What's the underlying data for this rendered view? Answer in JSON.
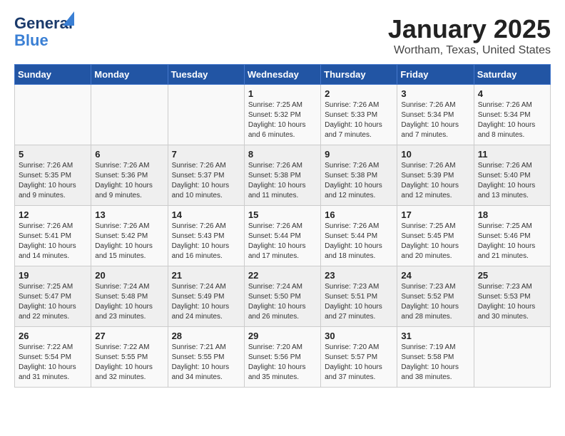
{
  "header": {
    "logo_line1": "General",
    "logo_line2": "Blue",
    "title": "January 2025",
    "subtitle": "Wortham, Texas, United States"
  },
  "weekdays": [
    "Sunday",
    "Monday",
    "Tuesday",
    "Wednesday",
    "Thursday",
    "Friday",
    "Saturday"
  ],
  "weeks": [
    [
      {
        "day": "",
        "info": ""
      },
      {
        "day": "",
        "info": ""
      },
      {
        "day": "",
        "info": ""
      },
      {
        "day": "1",
        "info": "Sunrise: 7:25 AM\nSunset: 5:32 PM\nDaylight: 10 hours\nand 6 minutes."
      },
      {
        "day": "2",
        "info": "Sunrise: 7:26 AM\nSunset: 5:33 PM\nDaylight: 10 hours\nand 7 minutes."
      },
      {
        "day": "3",
        "info": "Sunrise: 7:26 AM\nSunset: 5:34 PM\nDaylight: 10 hours\nand 7 minutes."
      },
      {
        "day": "4",
        "info": "Sunrise: 7:26 AM\nSunset: 5:34 PM\nDaylight: 10 hours\nand 8 minutes."
      }
    ],
    [
      {
        "day": "5",
        "info": "Sunrise: 7:26 AM\nSunset: 5:35 PM\nDaylight: 10 hours\nand 9 minutes."
      },
      {
        "day": "6",
        "info": "Sunrise: 7:26 AM\nSunset: 5:36 PM\nDaylight: 10 hours\nand 9 minutes."
      },
      {
        "day": "7",
        "info": "Sunrise: 7:26 AM\nSunset: 5:37 PM\nDaylight: 10 hours\nand 10 minutes."
      },
      {
        "day": "8",
        "info": "Sunrise: 7:26 AM\nSunset: 5:38 PM\nDaylight: 10 hours\nand 11 minutes."
      },
      {
        "day": "9",
        "info": "Sunrise: 7:26 AM\nSunset: 5:38 PM\nDaylight: 10 hours\nand 12 minutes."
      },
      {
        "day": "10",
        "info": "Sunrise: 7:26 AM\nSunset: 5:39 PM\nDaylight: 10 hours\nand 12 minutes."
      },
      {
        "day": "11",
        "info": "Sunrise: 7:26 AM\nSunset: 5:40 PM\nDaylight: 10 hours\nand 13 minutes."
      }
    ],
    [
      {
        "day": "12",
        "info": "Sunrise: 7:26 AM\nSunset: 5:41 PM\nDaylight: 10 hours\nand 14 minutes."
      },
      {
        "day": "13",
        "info": "Sunrise: 7:26 AM\nSunset: 5:42 PM\nDaylight: 10 hours\nand 15 minutes."
      },
      {
        "day": "14",
        "info": "Sunrise: 7:26 AM\nSunset: 5:43 PM\nDaylight: 10 hours\nand 16 minutes."
      },
      {
        "day": "15",
        "info": "Sunrise: 7:26 AM\nSunset: 5:44 PM\nDaylight: 10 hours\nand 17 minutes."
      },
      {
        "day": "16",
        "info": "Sunrise: 7:26 AM\nSunset: 5:44 PM\nDaylight: 10 hours\nand 18 minutes."
      },
      {
        "day": "17",
        "info": "Sunrise: 7:25 AM\nSunset: 5:45 PM\nDaylight: 10 hours\nand 20 minutes."
      },
      {
        "day": "18",
        "info": "Sunrise: 7:25 AM\nSunset: 5:46 PM\nDaylight: 10 hours\nand 21 minutes."
      }
    ],
    [
      {
        "day": "19",
        "info": "Sunrise: 7:25 AM\nSunset: 5:47 PM\nDaylight: 10 hours\nand 22 minutes."
      },
      {
        "day": "20",
        "info": "Sunrise: 7:24 AM\nSunset: 5:48 PM\nDaylight: 10 hours\nand 23 minutes."
      },
      {
        "day": "21",
        "info": "Sunrise: 7:24 AM\nSunset: 5:49 PM\nDaylight: 10 hours\nand 24 minutes."
      },
      {
        "day": "22",
        "info": "Sunrise: 7:24 AM\nSunset: 5:50 PM\nDaylight: 10 hours\nand 26 minutes."
      },
      {
        "day": "23",
        "info": "Sunrise: 7:23 AM\nSunset: 5:51 PM\nDaylight: 10 hours\nand 27 minutes."
      },
      {
        "day": "24",
        "info": "Sunrise: 7:23 AM\nSunset: 5:52 PM\nDaylight: 10 hours\nand 28 minutes."
      },
      {
        "day": "25",
        "info": "Sunrise: 7:23 AM\nSunset: 5:53 PM\nDaylight: 10 hours\nand 30 minutes."
      }
    ],
    [
      {
        "day": "26",
        "info": "Sunrise: 7:22 AM\nSunset: 5:54 PM\nDaylight: 10 hours\nand 31 minutes."
      },
      {
        "day": "27",
        "info": "Sunrise: 7:22 AM\nSunset: 5:55 PM\nDaylight: 10 hours\nand 32 minutes."
      },
      {
        "day": "28",
        "info": "Sunrise: 7:21 AM\nSunset: 5:55 PM\nDaylight: 10 hours\nand 34 minutes."
      },
      {
        "day": "29",
        "info": "Sunrise: 7:20 AM\nSunset: 5:56 PM\nDaylight: 10 hours\nand 35 minutes."
      },
      {
        "day": "30",
        "info": "Sunrise: 7:20 AM\nSunset: 5:57 PM\nDaylight: 10 hours\nand 37 minutes."
      },
      {
        "day": "31",
        "info": "Sunrise: 7:19 AM\nSunset: 5:58 PM\nDaylight: 10 hours\nand 38 minutes."
      },
      {
        "day": "",
        "info": ""
      }
    ]
  ]
}
